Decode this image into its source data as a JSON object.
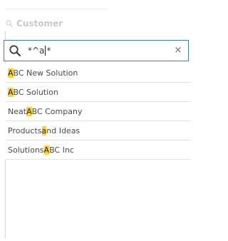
{
  "header": {
    "icon": "search-icon",
    "label": "Customer"
  },
  "search": {
    "icon": "search-icon",
    "value_before_caret": "*^a",
    "value_after_caret": "*",
    "clear_icon": "close-icon",
    "clear_glyph": "×",
    "border_color": "#3a7bbf"
  },
  "results": [
    {
      "pre": "",
      "match": "A",
      "post": "BC New Solution"
    },
    {
      "pre": "",
      "match": "A",
      "post": "BC Solution"
    },
    {
      "pre": "Neat ",
      "match": "A",
      "post": "BC Company"
    },
    {
      "pre": "Products ",
      "match": "a",
      "post": "nd Ideas"
    },
    {
      "pre": "Solutions ",
      "match": "A",
      "post": "BC Inc"
    }
  ],
  "colors": {
    "highlight": "#ffcf33",
    "row_border": "#e4e4e4",
    "header_text": "#c9c9c9"
  }
}
